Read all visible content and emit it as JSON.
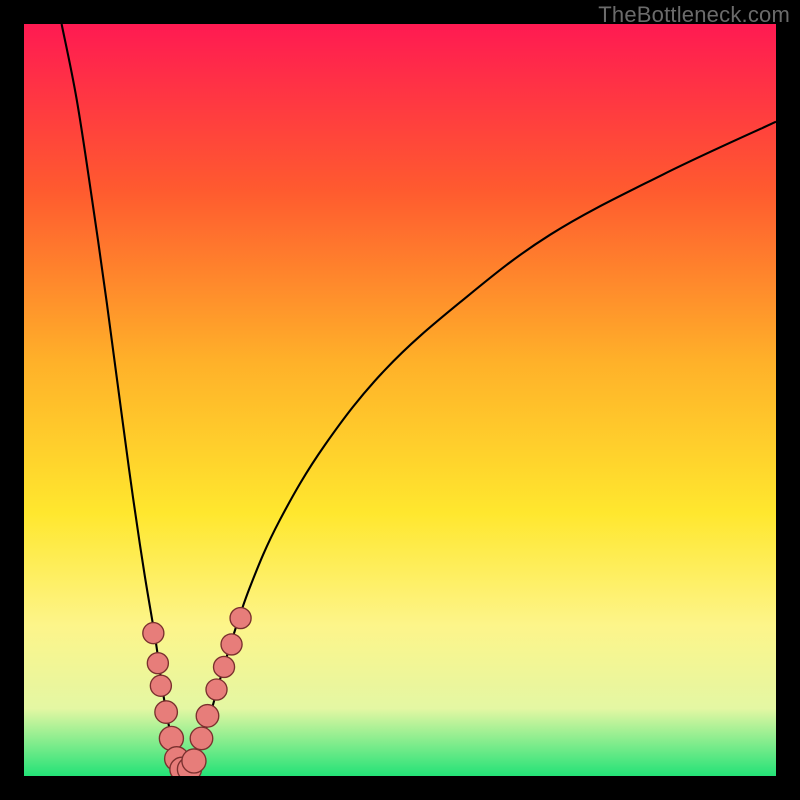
{
  "watermark": "TheBottleneck.com",
  "colors": {
    "frame": "#000000",
    "grad_top": "#ff1a52",
    "grad_mid1": "#ff5a2f",
    "grad_mid2": "#ffb129",
    "grad_mid3": "#ffe72e",
    "grad_low1": "#fdf58a",
    "grad_low2": "#e4f7a3",
    "grad_bottom": "#23e277",
    "curve": "#000000",
    "marker_fill": "#e77d7a",
    "marker_stroke": "#7a302e"
  },
  "chart_data": {
    "type": "line",
    "title": "",
    "xlabel": "",
    "ylabel": "",
    "xlim": [
      0,
      100
    ],
    "ylim": [
      0,
      100
    ],
    "series": [
      {
        "name": "left-branch",
        "x": [
          5,
          7,
          9,
          11,
          13,
          14.5,
          16,
          17.5,
          18.5,
          19.4,
          20,
          20.5,
          21
        ],
        "y": [
          100,
          90,
          77,
          63,
          48,
          37,
          27,
          18,
          11,
          6,
          3.5,
          1.8,
          0.8
        ]
      },
      {
        "name": "right-branch",
        "x": [
          22,
          22.8,
          23.8,
          25,
          27,
          30,
          34,
          40,
          48,
          58,
          70,
          85,
          100
        ],
        "y": [
          0.8,
          2,
          5,
          9,
          16,
          25,
          34,
          44,
          54,
          63,
          72,
          80,
          87
        ]
      }
    ],
    "markers_left": {
      "name": "cluster-left",
      "points": [
        {
          "x": 17.2,
          "y": 19.0,
          "r": 1.4
        },
        {
          "x": 17.8,
          "y": 15.0,
          "r": 1.4
        },
        {
          "x": 18.2,
          "y": 12.0,
          "r": 1.4
        },
        {
          "x": 18.9,
          "y": 8.5,
          "r": 1.5
        },
        {
          "x": 19.6,
          "y": 5.0,
          "r": 1.6
        },
        {
          "x": 20.3,
          "y": 2.3,
          "r": 1.6
        },
        {
          "x": 21.0,
          "y": 0.9,
          "r": 1.6
        }
      ]
    },
    "markers_right": {
      "name": "cluster-right",
      "points": [
        {
          "x": 22.0,
          "y": 0.9,
          "r": 1.6
        },
        {
          "x": 22.6,
          "y": 2.0,
          "r": 1.6
        },
        {
          "x": 23.6,
          "y": 5.0,
          "r": 1.5
        },
        {
          "x": 24.4,
          "y": 8.0,
          "r": 1.5
        },
        {
          "x": 25.6,
          "y": 11.5,
          "r": 1.4
        },
        {
          "x": 26.6,
          "y": 14.5,
          "r": 1.4
        },
        {
          "x": 27.6,
          "y": 17.5,
          "r": 1.4
        },
        {
          "x": 28.8,
          "y": 21.0,
          "r": 1.4
        }
      ]
    }
  }
}
